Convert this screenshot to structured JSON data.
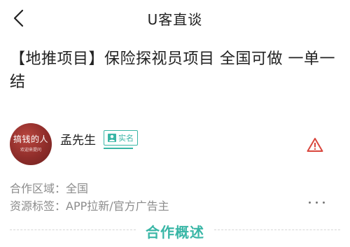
{
  "header": {
    "title": "U客直谈"
  },
  "post": {
    "title": "【地推项目】保险探视员项目 全国可做 一单一结"
  },
  "author": {
    "name": "孟先生",
    "verified_label": "实名",
    "avatar_text": "搞钱的人",
    "avatar_subtext": "欢迎来提问"
  },
  "info": {
    "region": "合作区域：全国",
    "tags": "资源标签：APP拉新/官方广告主"
  },
  "section": {
    "title": "合作概述"
  },
  "colors": {
    "accent": "#39b6a6",
    "warning": "#d9463d"
  }
}
